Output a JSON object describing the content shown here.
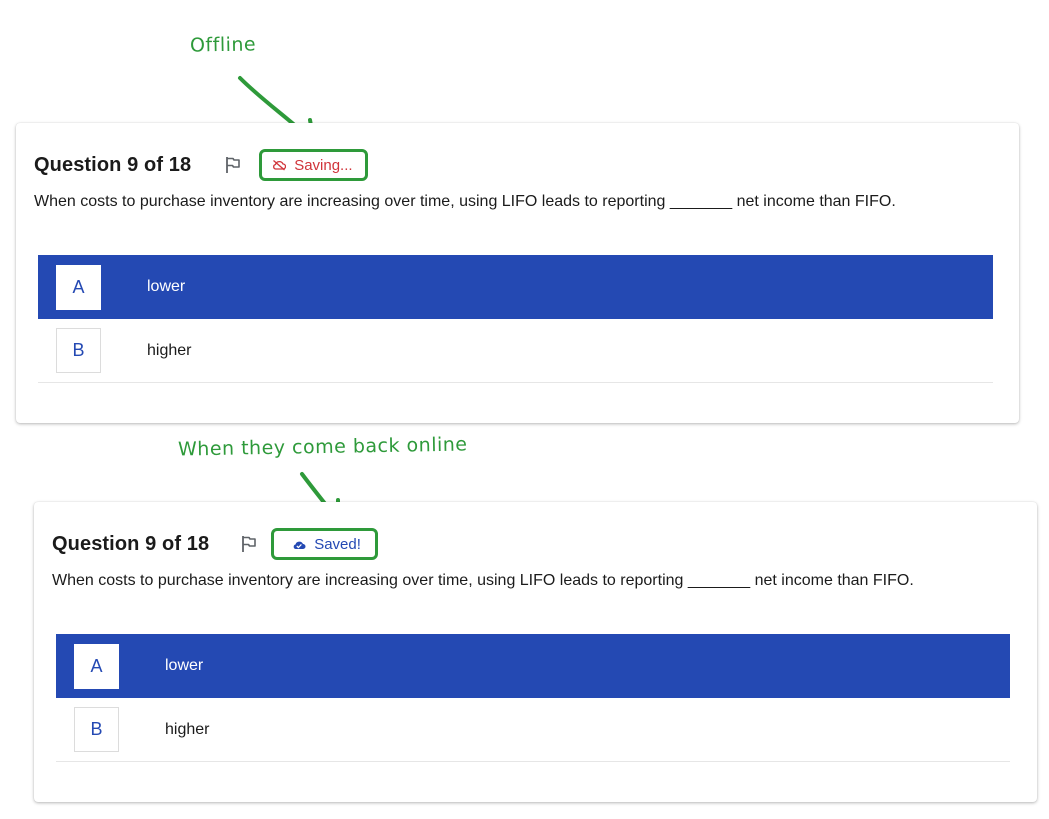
{
  "annotations": {
    "offline": "Offline",
    "online": "When they come back online"
  },
  "colors": {
    "annotation": "#2e9a3a",
    "selected_option": "#2449b3",
    "saving_text": "#d0343a",
    "saved_text": "#2449b3"
  },
  "panels": [
    {
      "title": "Question 9 of 18",
      "flag_icon": "flag-icon",
      "status": {
        "icon": "cloud-offline-icon",
        "label": "Saving...",
        "color": "#d0343a"
      },
      "question": "When costs to purchase inventory are increasing over time, using LIFO leads to reporting  _______  net income than FIFO.",
      "options": [
        {
          "letter": "A",
          "label": "lower",
          "selected": true
        },
        {
          "letter": "B",
          "label": "higher",
          "selected": false
        }
      ]
    },
    {
      "title": "Question 9 of 18",
      "flag_icon": "flag-icon",
      "status": {
        "icon": "cloud-saved-icon",
        "label": "Saved!",
        "color": "#2449b3"
      },
      "question": "When costs to purchase inventory are increasing over time, using LIFO leads to reporting  _______  net income than FIFO.",
      "options": [
        {
          "letter": "A",
          "label": "lower",
          "selected": true
        },
        {
          "letter": "B",
          "label": "higher",
          "selected": false
        }
      ]
    }
  ]
}
